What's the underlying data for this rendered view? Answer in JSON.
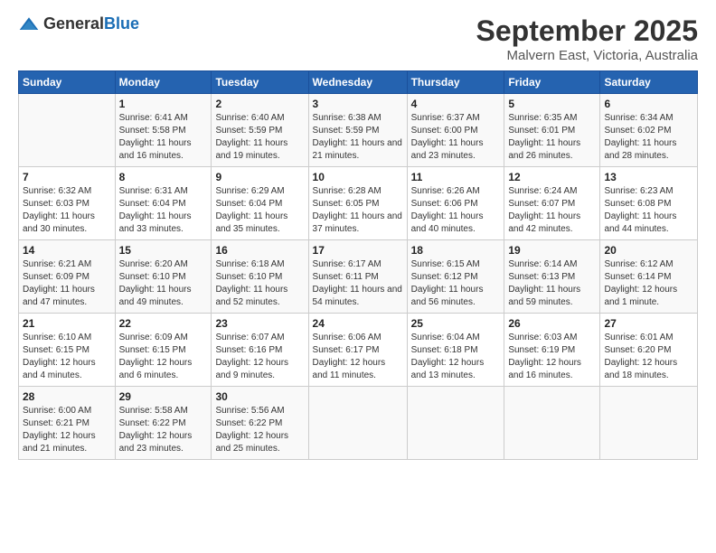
{
  "logo": {
    "general": "General",
    "blue": "Blue"
  },
  "header": {
    "month": "September 2025",
    "location": "Malvern East, Victoria, Australia"
  },
  "weekdays": [
    "Sunday",
    "Monday",
    "Tuesday",
    "Wednesday",
    "Thursday",
    "Friday",
    "Saturday"
  ],
  "weeks": [
    [
      {
        "day": "",
        "sunrise": "",
        "sunset": "",
        "daylight": ""
      },
      {
        "day": "1",
        "sunrise": "Sunrise: 6:41 AM",
        "sunset": "Sunset: 5:58 PM",
        "daylight": "Daylight: 11 hours and 16 minutes."
      },
      {
        "day": "2",
        "sunrise": "Sunrise: 6:40 AM",
        "sunset": "Sunset: 5:59 PM",
        "daylight": "Daylight: 11 hours and 19 minutes."
      },
      {
        "day": "3",
        "sunrise": "Sunrise: 6:38 AM",
        "sunset": "Sunset: 5:59 PM",
        "daylight": "Daylight: 11 hours and 21 minutes."
      },
      {
        "day": "4",
        "sunrise": "Sunrise: 6:37 AM",
        "sunset": "Sunset: 6:00 PM",
        "daylight": "Daylight: 11 hours and 23 minutes."
      },
      {
        "day": "5",
        "sunrise": "Sunrise: 6:35 AM",
        "sunset": "Sunset: 6:01 PM",
        "daylight": "Daylight: 11 hours and 26 minutes."
      },
      {
        "day": "6",
        "sunrise": "Sunrise: 6:34 AM",
        "sunset": "Sunset: 6:02 PM",
        "daylight": "Daylight: 11 hours and 28 minutes."
      }
    ],
    [
      {
        "day": "7",
        "sunrise": "Sunrise: 6:32 AM",
        "sunset": "Sunset: 6:03 PM",
        "daylight": "Daylight: 11 hours and 30 minutes."
      },
      {
        "day": "8",
        "sunrise": "Sunrise: 6:31 AM",
        "sunset": "Sunset: 6:04 PM",
        "daylight": "Daylight: 11 hours and 33 minutes."
      },
      {
        "day": "9",
        "sunrise": "Sunrise: 6:29 AM",
        "sunset": "Sunset: 6:04 PM",
        "daylight": "Daylight: 11 hours and 35 minutes."
      },
      {
        "day": "10",
        "sunrise": "Sunrise: 6:28 AM",
        "sunset": "Sunset: 6:05 PM",
        "daylight": "Daylight: 11 hours and 37 minutes."
      },
      {
        "day": "11",
        "sunrise": "Sunrise: 6:26 AM",
        "sunset": "Sunset: 6:06 PM",
        "daylight": "Daylight: 11 hours and 40 minutes."
      },
      {
        "day": "12",
        "sunrise": "Sunrise: 6:24 AM",
        "sunset": "Sunset: 6:07 PM",
        "daylight": "Daylight: 11 hours and 42 minutes."
      },
      {
        "day": "13",
        "sunrise": "Sunrise: 6:23 AM",
        "sunset": "Sunset: 6:08 PM",
        "daylight": "Daylight: 11 hours and 44 minutes."
      }
    ],
    [
      {
        "day": "14",
        "sunrise": "Sunrise: 6:21 AM",
        "sunset": "Sunset: 6:09 PM",
        "daylight": "Daylight: 11 hours and 47 minutes."
      },
      {
        "day": "15",
        "sunrise": "Sunrise: 6:20 AM",
        "sunset": "Sunset: 6:10 PM",
        "daylight": "Daylight: 11 hours and 49 minutes."
      },
      {
        "day": "16",
        "sunrise": "Sunrise: 6:18 AM",
        "sunset": "Sunset: 6:10 PM",
        "daylight": "Daylight: 11 hours and 52 minutes."
      },
      {
        "day": "17",
        "sunrise": "Sunrise: 6:17 AM",
        "sunset": "Sunset: 6:11 PM",
        "daylight": "Daylight: 11 hours and 54 minutes."
      },
      {
        "day": "18",
        "sunrise": "Sunrise: 6:15 AM",
        "sunset": "Sunset: 6:12 PM",
        "daylight": "Daylight: 11 hours and 56 minutes."
      },
      {
        "day": "19",
        "sunrise": "Sunrise: 6:14 AM",
        "sunset": "Sunset: 6:13 PM",
        "daylight": "Daylight: 11 hours and 59 minutes."
      },
      {
        "day": "20",
        "sunrise": "Sunrise: 6:12 AM",
        "sunset": "Sunset: 6:14 PM",
        "daylight": "Daylight: 12 hours and 1 minute."
      }
    ],
    [
      {
        "day": "21",
        "sunrise": "Sunrise: 6:10 AM",
        "sunset": "Sunset: 6:15 PM",
        "daylight": "Daylight: 12 hours and 4 minutes."
      },
      {
        "day": "22",
        "sunrise": "Sunrise: 6:09 AM",
        "sunset": "Sunset: 6:15 PM",
        "daylight": "Daylight: 12 hours and 6 minutes."
      },
      {
        "day": "23",
        "sunrise": "Sunrise: 6:07 AM",
        "sunset": "Sunset: 6:16 PM",
        "daylight": "Daylight: 12 hours and 9 minutes."
      },
      {
        "day": "24",
        "sunrise": "Sunrise: 6:06 AM",
        "sunset": "Sunset: 6:17 PM",
        "daylight": "Daylight: 12 hours and 11 minutes."
      },
      {
        "day": "25",
        "sunrise": "Sunrise: 6:04 AM",
        "sunset": "Sunset: 6:18 PM",
        "daylight": "Daylight: 12 hours and 13 minutes."
      },
      {
        "day": "26",
        "sunrise": "Sunrise: 6:03 AM",
        "sunset": "Sunset: 6:19 PM",
        "daylight": "Daylight: 12 hours and 16 minutes."
      },
      {
        "day": "27",
        "sunrise": "Sunrise: 6:01 AM",
        "sunset": "Sunset: 6:20 PM",
        "daylight": "Daylight: 12 hours and 18 minutes."
      }
    ],
    [
      {
        "day": "28",
        "sunrise": "Sunrise: 6:00 AM",
        "sunset": "Sunset: 6:21 PM",
        "daylight": "Daylight: 12 hours and 21 minutes."
      },
      {
        "day": "29",
        "sunrise": "Sunrise: 5:58 AM",
        "sunset": "Sunset: 6:22 PM",
        "daylight": "Daylight: 12 hours and 23 minutes."
      },
      {
        "day": "30",
        "sunrise": "Sunrise: 5:56 AM",
        "sunset": "Sunset: 6:22 PM",
        "daylight": "Daylight: 12 hours and 25 minutes."
      },
      {
        "day": "",
        "sunrise": "",
        "sunset": "",
        "daylight": ""
      },
      {
        "day": "",
        "sunrise": "",
        "sunset": "",
        "daylight": ""
      },
      {
        "day": "",
        "sunrise": "",
        "sunset": "",
        "daylight": ""
      },
      {
        "day": "",
        "sunrise": "",
        "sunset": "",
        "daylight": ""
      }
    ]
  ]
}
